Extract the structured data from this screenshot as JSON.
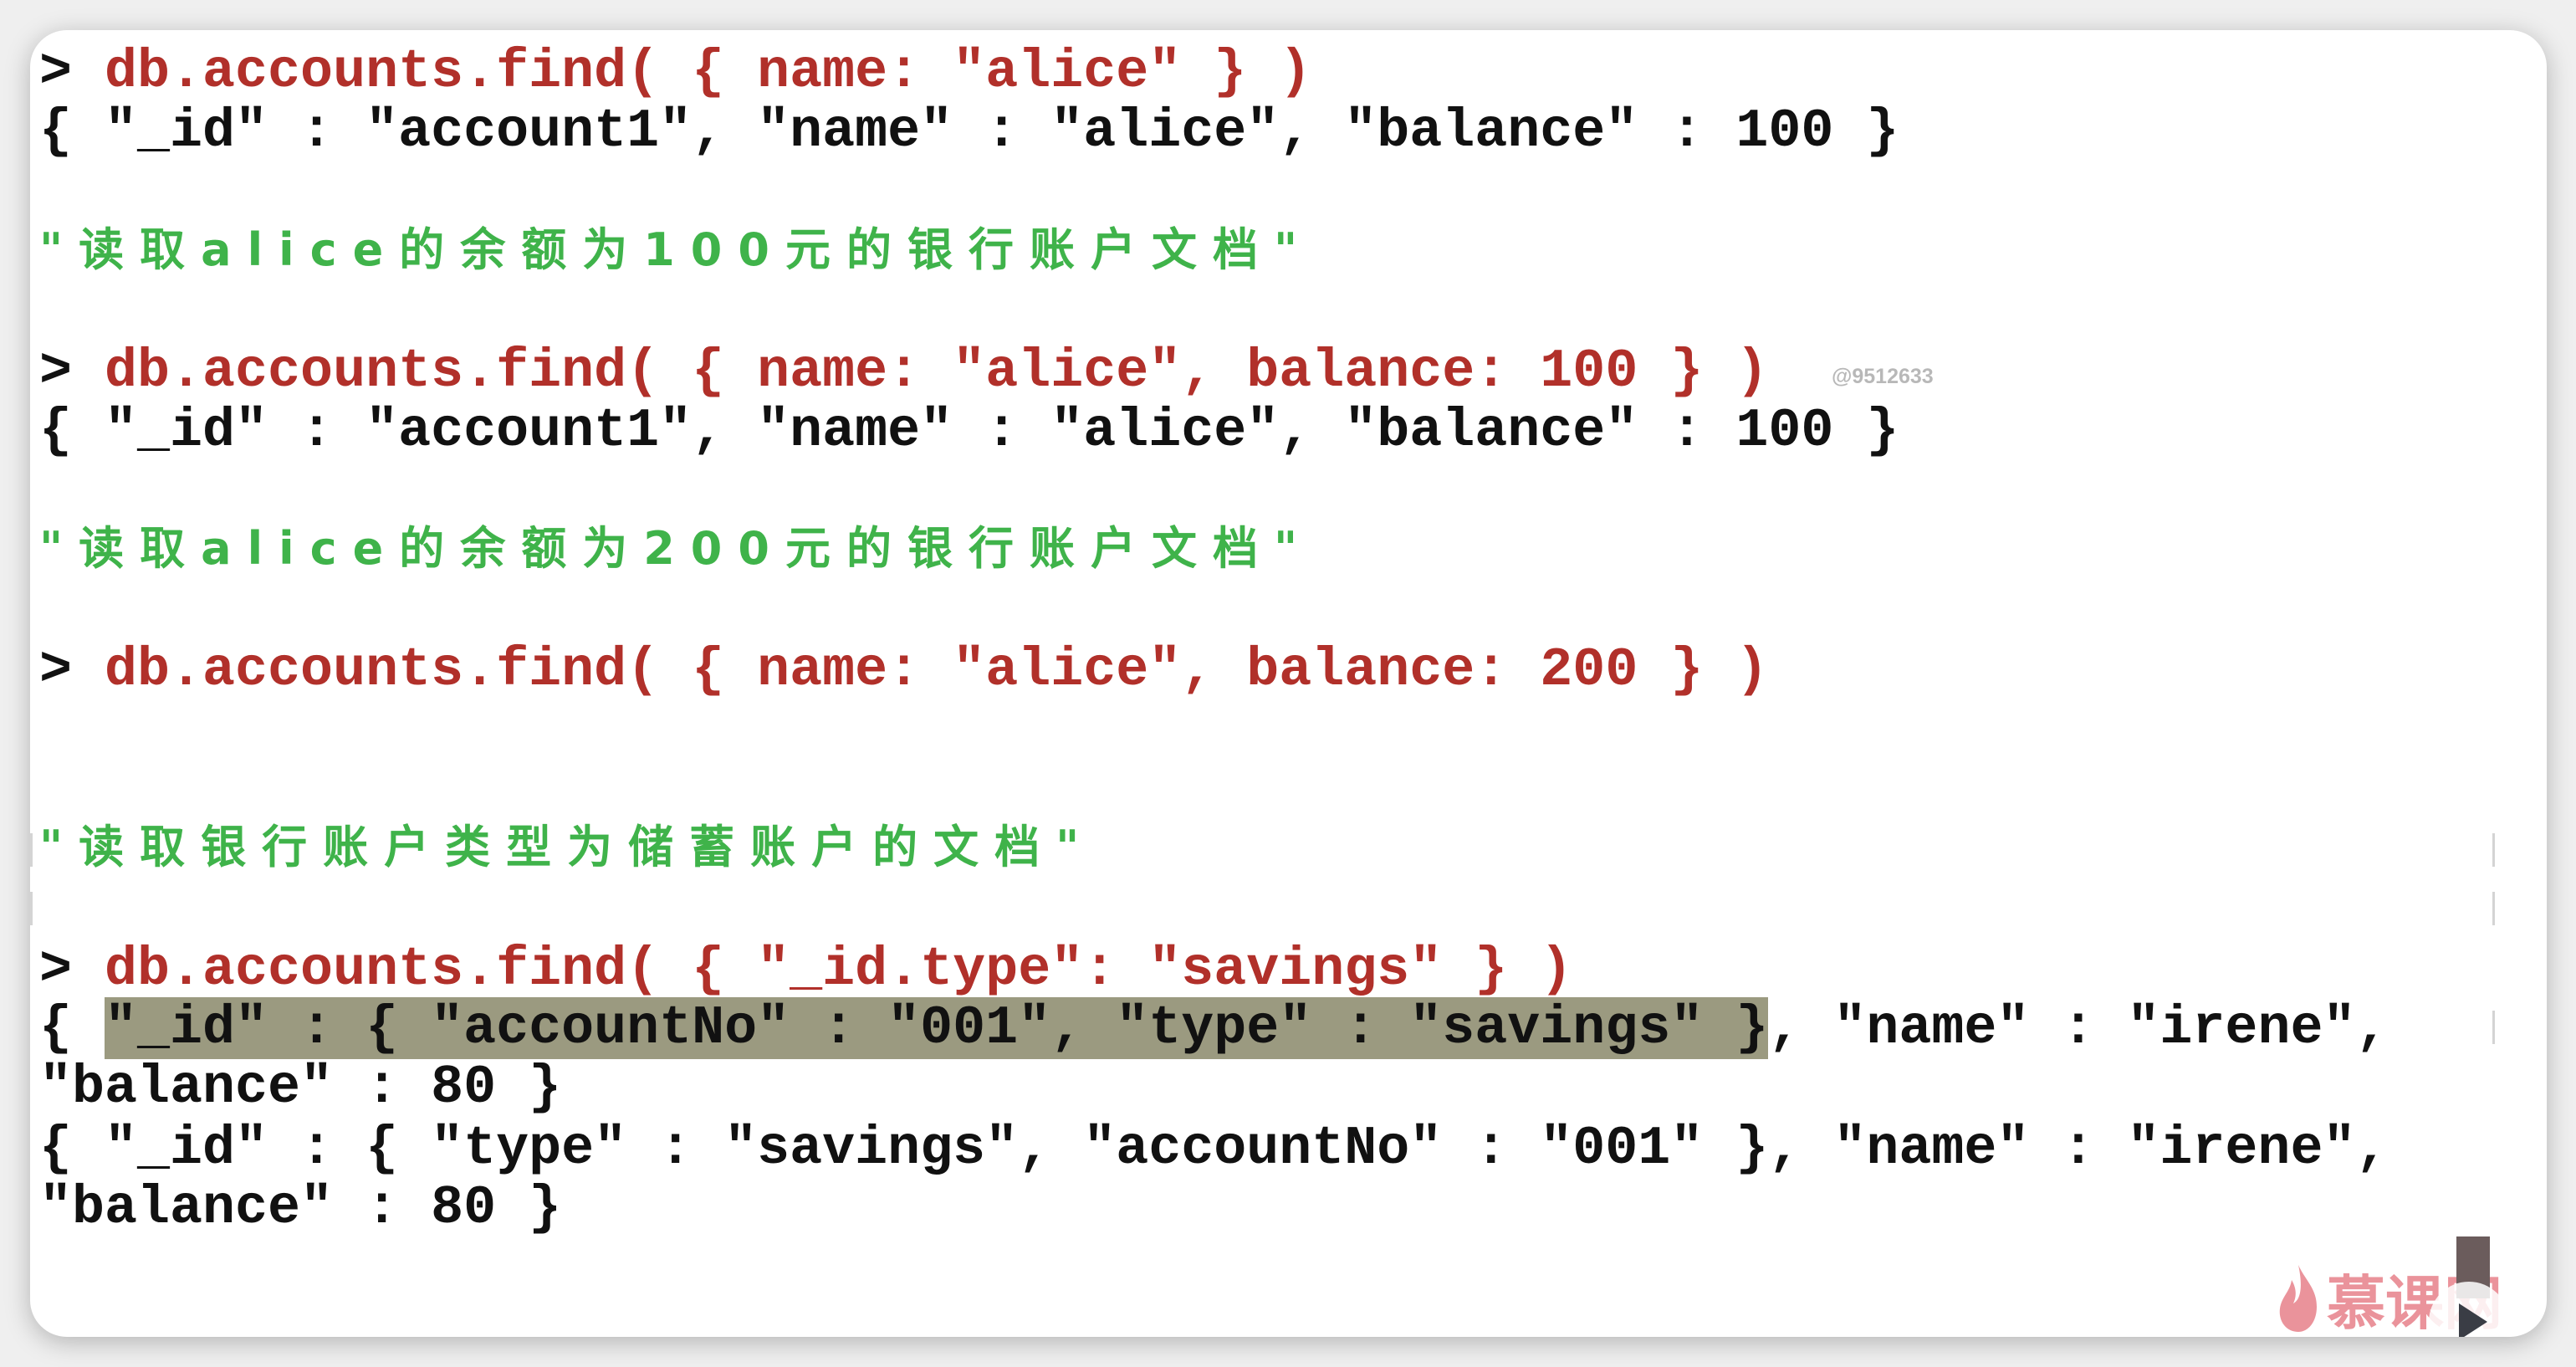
{
  "terminal": {
    "lines": [
      {
        "prompt": ">",
        "cmd": " db.accounts.find( { name: \"alice\" } )"
      },
      {
        "out": "{ \"_id\" : \"account1\", \"name\" : \"alice\", \"balance\" : 100 }"
      },
      {
        "comment": "\"读取alice的余额为100元的银行账户文档\""
      },
      {
        "prompt": ">",
        "cmd": " db.accounts.find( { name: \"alice\", balance: 100 } )"
      },
      {
        "out": "{ \"_id\" : \"account1\", \"name\" : \"alice\", \"balance\" : 100 }"
      },
      {
        "comment": "\"读取alice的余额为200元的银行账户文档\""
      },
      {
        "prompt": ">",
        "cmd": " db.accounts.find( { name: \"alice\", balance: 200 } )"
      },
      {
        "comment": "\"读取银行账户类型为储蓄账户的文档\""
      },
      {
        "prompt": ">",
        "cmd": " db.accounts.find( { \"_id.type\": \"savings\" } )"
      },
      {
        "pre": "{ ",
        "highlight": "\"_id\" : { \"accountNo\" : \"001\", \"type\" : \"savings\" }",
        "post": ", \"name\" : \"irene\","
      },
      {
        "out": "\"balance\" : 80 }"
      },
      {
        "out": "{ \"_id\" : { \"type\" : \"savings\", \"accountNo\" : \"001\" }, \"name\" : \"irene\","
      },
      {
        "out": "\"balance\" : 80 }"
      }
    ]
  },
  "watermark": "@9512633",
  "logo": {
    "text": "慕课网",
    "icon": "flame-icon",
    "color": "#e05a66"
  },
  "player": {
    "icon": "play-icon"
  },
  "colors": {
    "command": "#b1302a",
    "comment": "#3fb34a",
    "output": "#111111",
    "highlight": "#9b9a80"
  }
}
